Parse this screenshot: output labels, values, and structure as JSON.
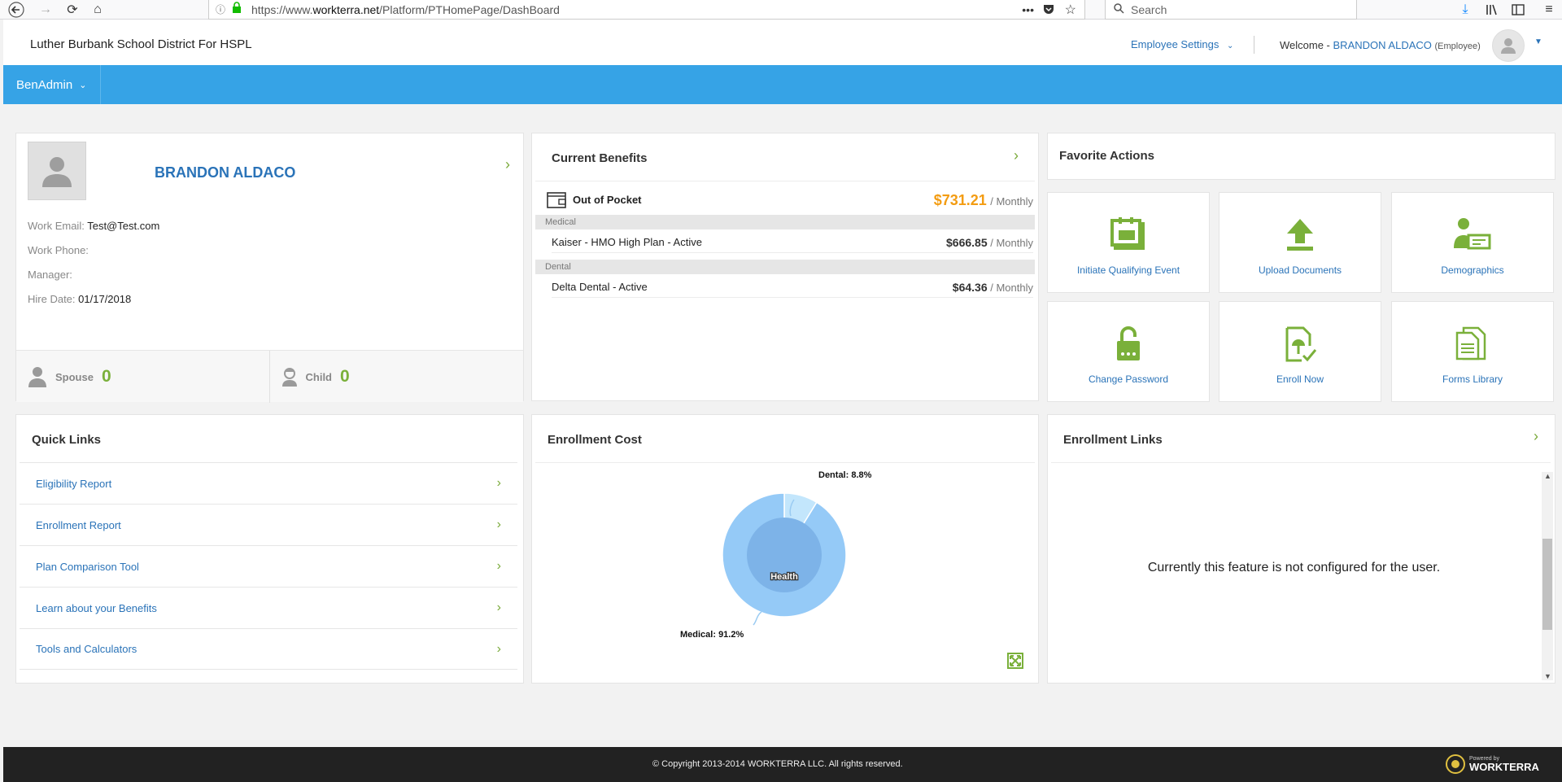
{
  "browser": {
    "url_prefix": "https://www.",
    "url_domain": "workterra.net",
    "url_path": "/Platform/PTHomePage/DashBoard",
    "search_placeholder": "Search"
  },
  "header": {
    "org_name": "Luther Burbank School District For HSPL",
    "employee_settings": "Employee Settings",
    "welcome_label": "Welcome -",
    "user_name": "BRANDON ALDACO",
    "user_role": "(Employee)"
  },
  "nav": {
    "menu_label": "BenAdmin"
  },
  "profile": {
    "name": "BRANDON ALDACO",
    "fields": [
      {
        "label": "Work Email:",
        "value": "Test@Test.com"
      },
      {
        "label": "Work Phone:",
        "value": ""
      },
      {
        "label": "Manager:",
        "value": ""
      },
      {
        "label": "Hire Date:",
        "value": "01/17/2018"
      }
    ],
    "spouse_label": "Spouse",
    "spouse_count": "0",
    "child_label": "Child",
    "child_count": "0"
  },
  "current_benefits": {
    "title": "Current Benefits",
    "out_of_pocket_label": "Out of Pocket",
    "out_of_pocket_amount": "$731.21",
    "per_label": "/ Monthly",
    "sections": [
      {
        "name": "Medical",
        "plan": "Kaiser - HMO High Plan - Active",
        "amount": "$666.85"
      },
      {
        "name": "Dental",
        "plan": "Delta Dental - Active",
        "amount": "$64.36"
      }
    ]
  },
  "favorite_actions": {
    "title": "Favorite Actions",
    "tiles": [
      {
        "label": "Initiate Qualifying Event",
        "icon": "calendar-event-icon"
      },
      {
        "label": "Upload Documents",
        "icon": "upload-icon"
      },
      {
        "label": "Demographics",
        "icon": "id-card-icon"
      },
      {
        "label": "Change Password",
        "icon": "lock-icon"
      },
      {
        "label": "Enroll Now",
        "icon": "enroll-document-icon"
      },
      {
        "label": "Forms Library",
        "icon": "forms-icon"
      }
    ]
  },
  "quick_links": {
    "title": "Quick Links",
    "items": [
      "Eligibility Report",
      "Enrollment Report",
      "Plan Comparison Tool",
      "Learn about your Benefits",
      "Tools and Calculators"
    ]
  },
  "enrollment_cost": {
    "title": "Enrollment Cost",
    "center_label": "Health",
    "dental_label": "Dental: 8.8%",
    "medical_label": "Medical: 91.2%"
  },
  "chart_data": {
    "type": "pie",
    "categories": [
      "Medical",
      "Dental"
    ],
    "values": [
      91.2,
      8.8
    ],
    "inner_label": "Health",
    "colors": {
      "Medical": "#95caf7",
      "Dental": "#c3e6fc",
      "inner": "#7db3e8"
    }
  },
  "enrollment_links": {
    "title": "Enrollment Links",
    "message": "Currently this feature is not configured for the user."
  },
  "footer": {
    "copyright": "© Copyright 2013-2014 WORKTERRA LLC. All rights reserved.",
    "powered_by": "Powered by",
    "brand": "WORKTERRA"
  },
  "colors": {
    "accent_blue": "#36a3e6",
    "link_blue": "#2a73b8",
    "green": "#7ab03a",
    "orange": "#f39c12"
  }
}
